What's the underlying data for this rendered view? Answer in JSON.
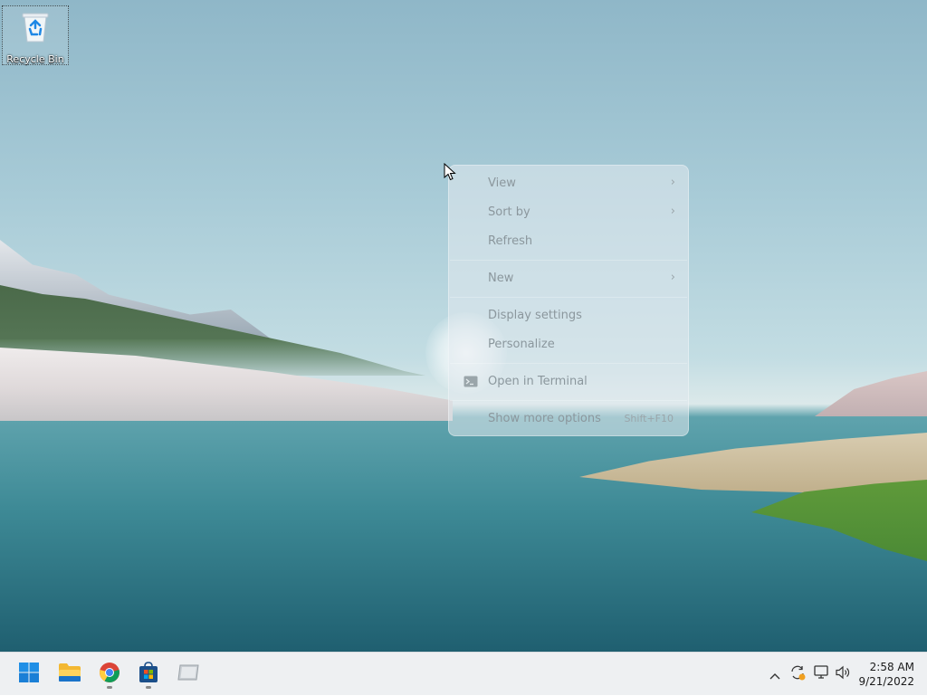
{
  "desktop": {
    "icons": [
      {
        "label": "Recycle Bin",
        "icon": "recycle-bin-icon"
      }
    ]
  },
  "context_menu": {
    "items": [
      {
        "label": "View",
        "submenu": true
      },
      {
        "label": "Sort by",
        "submenu": true
      },
      {
        "label": "Refresh",
        "submenu": false
      },
      {
        "label": "New",
        "submenu": true
      },
      {
        "label": "Display settings",
        "submenu": false
      },
      {
        "label": "Personalize",
        "submenu": false
      },
      {
        "label": "Open in Terminal",
        "icon": "terminal-icon",
        "submenu": false
      },
      {
        "label": "Show more options",
        "shortcut": "Shift+F10",
        "submenu": false
      }
    ]
  },
  "taskbar": {
    "apps": [
      {
        "name": "Start",
        "icon": "windows-start-icon"
      },
      {
        "name": "File Explorer",
        "icon": "file-explorer-icon"
      },
      {
        "name": "Google Chrome",
        "icon": "chrome-icon",
        "running": true
      },
      {
        "name": "Microsoft Store",
        "icon": "microsoft-store-icon",
        "running": true
      },
      {
        "name": "App",
        "icon": "generic-app-icon"
      }
    ],
    "tray_icons": [
      "chevron-up-icon",
      "update-sync-icon",
      "network-icon",
      "volume-icon"
    ],
    "clock": {
      "time": "2:58 AM",
      "date": "9/21/2022"
    }
  },
  "colors": {
    "taskbar_bg": "#eef0f2",
    "menu_text_disabled": "#8b979d",
    "start_blue": "#0078d4"
  }
}
